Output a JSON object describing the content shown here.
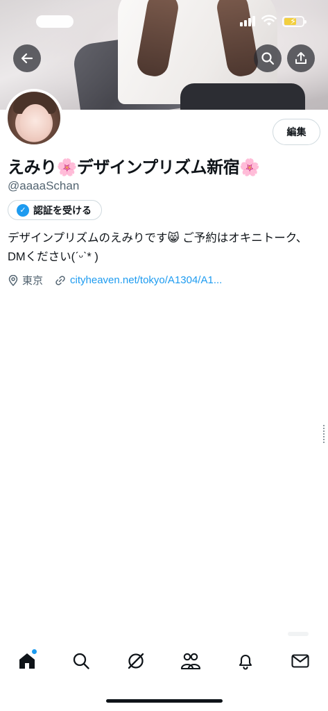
{
  "banner": {
    "description_icon": "profile-banner"
  },
  "status_bar": {
    "icons": [
      "signal-icon",
      "wifi-icon",
      "battery-charging-icon"
    ]
  },
  "header": {
    "back_icon": "back-arrow-icon",
    "search_icon": "search-icon",
    "share_icon": "share-icon"
  },
  "profile": {
    "edit_label": "編集",
    "display_name": "えみり🌸デザインプリズム新宿🌸",
    "handle": "@aaaaSchan",
    "verify_label": "認証を受ける",
    "bio": "デザインプリズムのえみりです😸 ご予約はオキニトーク、DMください(ˊᵕˋ* )",
    "location": "東京",
    "link": "cityheaven.net/tokyo/A1304/A1..."
  },
  "tabbar": {
    "items": [
      "home-icon",
      "search-icon",
      "grok-icon",
      "communities-icon",
      "notifications-icon",
      "messages-icon"
    ],
    "accent": "#1d9bf0"
  },
  "colors": {
    "accent": "#1d9bf0",
    "text": "#0f1419",
    "muted": "#536471",
    "border": "#cfd9de"
  }
}
